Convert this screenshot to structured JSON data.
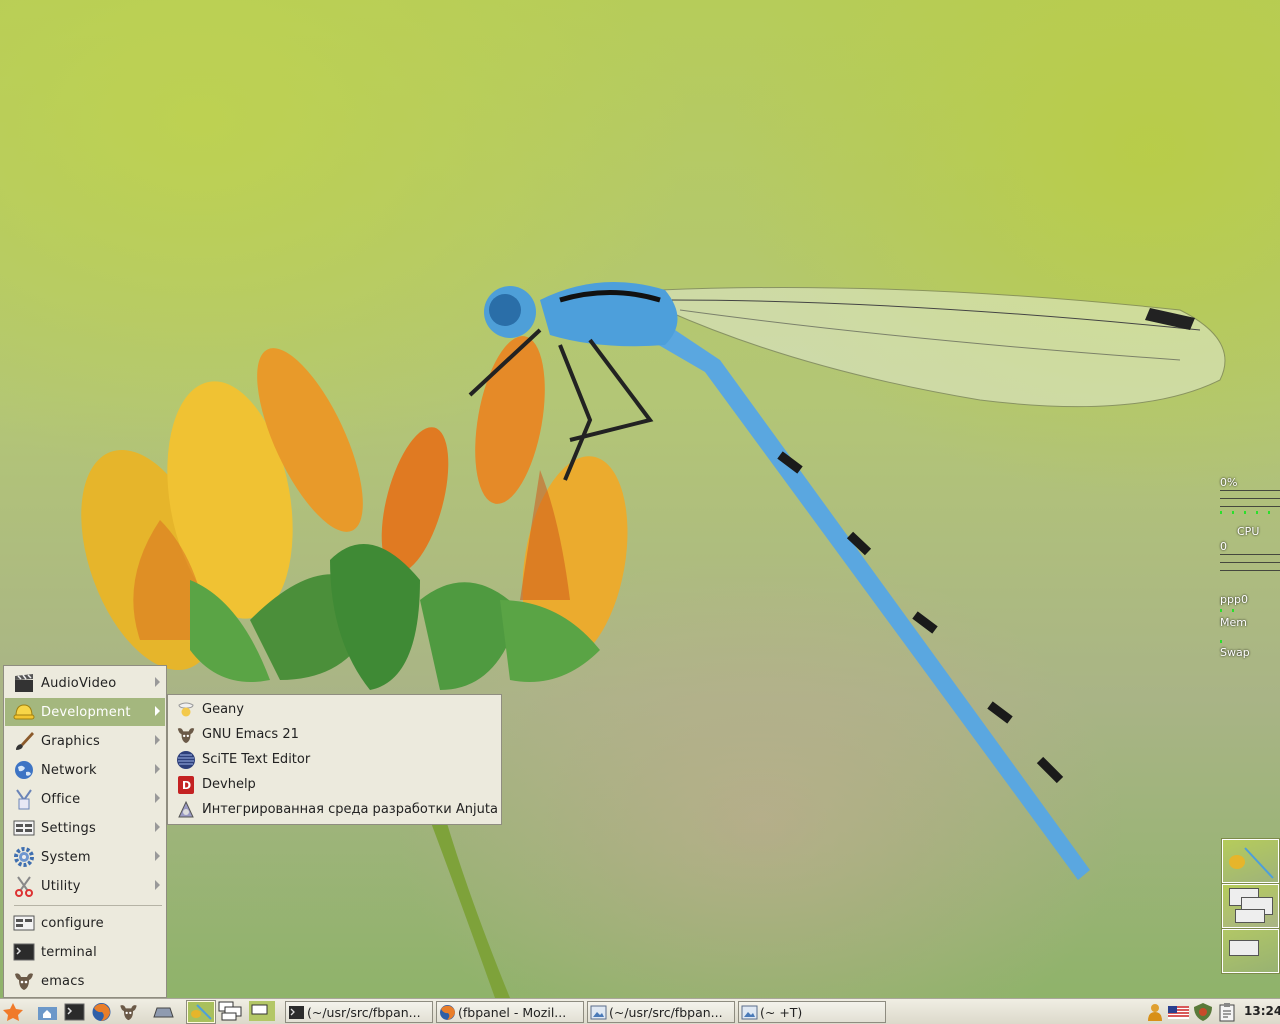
{
  "monitor": {
    "cpu_percent": "0%",
    "cpu_label": "CPU",
    "net_value": "0",
    "net_iface": "ppp0",
    "mem_label": "Mem",
    "swap_label": "Swap"
  },
  "main_menu": {
    "items": [
      {
        "label": "AudioVideo",
        "icon": "clapperboard-icon",
        "submenu": true
      },
      {
        "label": "Development",
        "icon": "hardhat-icon",
        "submenu": true,
        "active": true
      },
      {
        "label": "Graphics",
        "icon": "paintbrush-icon",
        "submenu": true
      },
      {
        "label": "Network",
        "icon": "globe-icon",
        "submenu": true
      },
      {
        "label": "Office",
        "icon": "office-icon",
        "submenu": true
      },
      {
        "label": "Settings",
        "icon": "settings-icon",
        "submenu": true
      },
      {
        "label": "System",
        "icon": "gear-icon",
        "submenu": true
      },
      {
        "label": "Utility",
        "icon": "scissors-icon",
        "submenu": true
      }
    ],
    "actions": [
      {
        "label": "configure",
        "icon": "configure-icon"
      },
      {
        "label": "terminal",
        "icon": "terminal-icon"
      },
      {
        "label": "emacs",
        "icon": "gnu-icon"
      }
    ]
  },
  "dev_submenu": {
    "items": [
      {
        "label": "Geany",
        "icon": "geany-icon"
      },
      {
        "label": "GNU Emacs 21",
        "icon": "gnu-icon"
      },
      {
        "label": "SciTE Text Editor",
        "icon": "scite-icon"
      },
      {
        "label": "Devhelp",
        "icon": "devhelp-icon"
      },
      {
        "label": "Интегрированная среда разработки Anjuta",
        "icon": "anjuta-icon"
      }
    ]
  },
  "taskbar": {
    "launchers": [
      "menu-icon",
      "home-folder-icon",
      "terminal-icon",
      "firefox-icon",
      "gnu-icon",
      "show-desktop-icon"
    ],
    "tasks": [
      {
        "title": "(~/usr/src/fbpan...",
        "icon": "terminal-icon"
      },
      {
        "title": "(fbpanel - Mozil...",
        "icon": "firefox-icon"
      },
      {
        "title": "(~/usr/src/fbpan...",
        "icon": "image-viewer-icon"
      },
      {
        "title": "(~ +T)",
        "icon": "image-viewer-icon"
      }
    ],
    "tray": [
      "user-icon",
      "us-flag-icon",
      "shield-icon",
      "clipboard-icon"
    ],
    "clock": "13:24"
  },
  "colors": {
    "menu_bg": "#eceadd",
    "menu_active": "#a4b77e",
    "taskbar_bg": "#dcd9cb",
    "monitor_green": "#2be02b"
  }
}
